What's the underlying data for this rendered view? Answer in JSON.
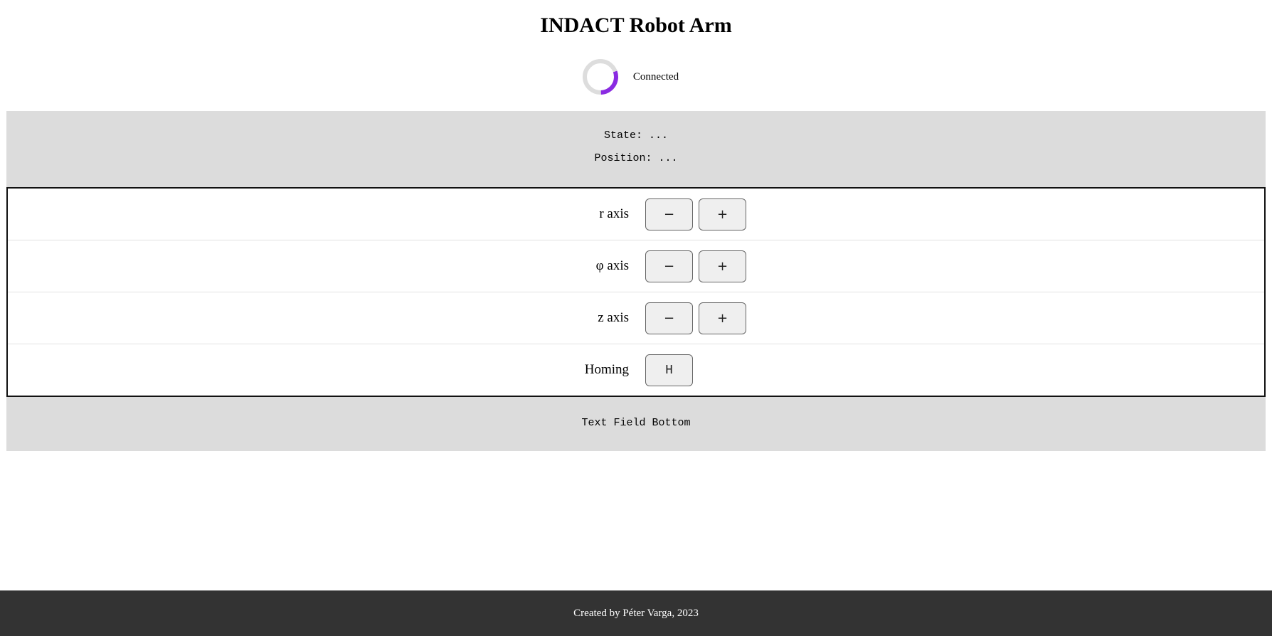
{
  "header": {
    "title": "INDACT Robot Arm"
  },
  "connection": {
    "status": "Connected",
    "indicator_progress": 0.3,
    "track_color": "#dddddd",
    "arc_color": "#8a2be2"
  },
  "info": {
    "state": "State: ...",
    "position": "Position: ..."
  },
  "controls": {
    "rows": [
      {
        "label": "r axis",
        "minus": "−",
        "plus": "+"
      },
      {
        "label": "φ axis",
        "minus": "−",
        "plus": "+"
      },
      {
        "label": "z axis",
        "minus": "−",
        "plus": "+"
      },
      {
        "label": "Homing",
        "home": "H"
      }
    ]
  },
  "bottom_text": "Text Field Bottom",
  "footer": {
    "credit": "Created by Péter Varga, 2023"
  }
}
